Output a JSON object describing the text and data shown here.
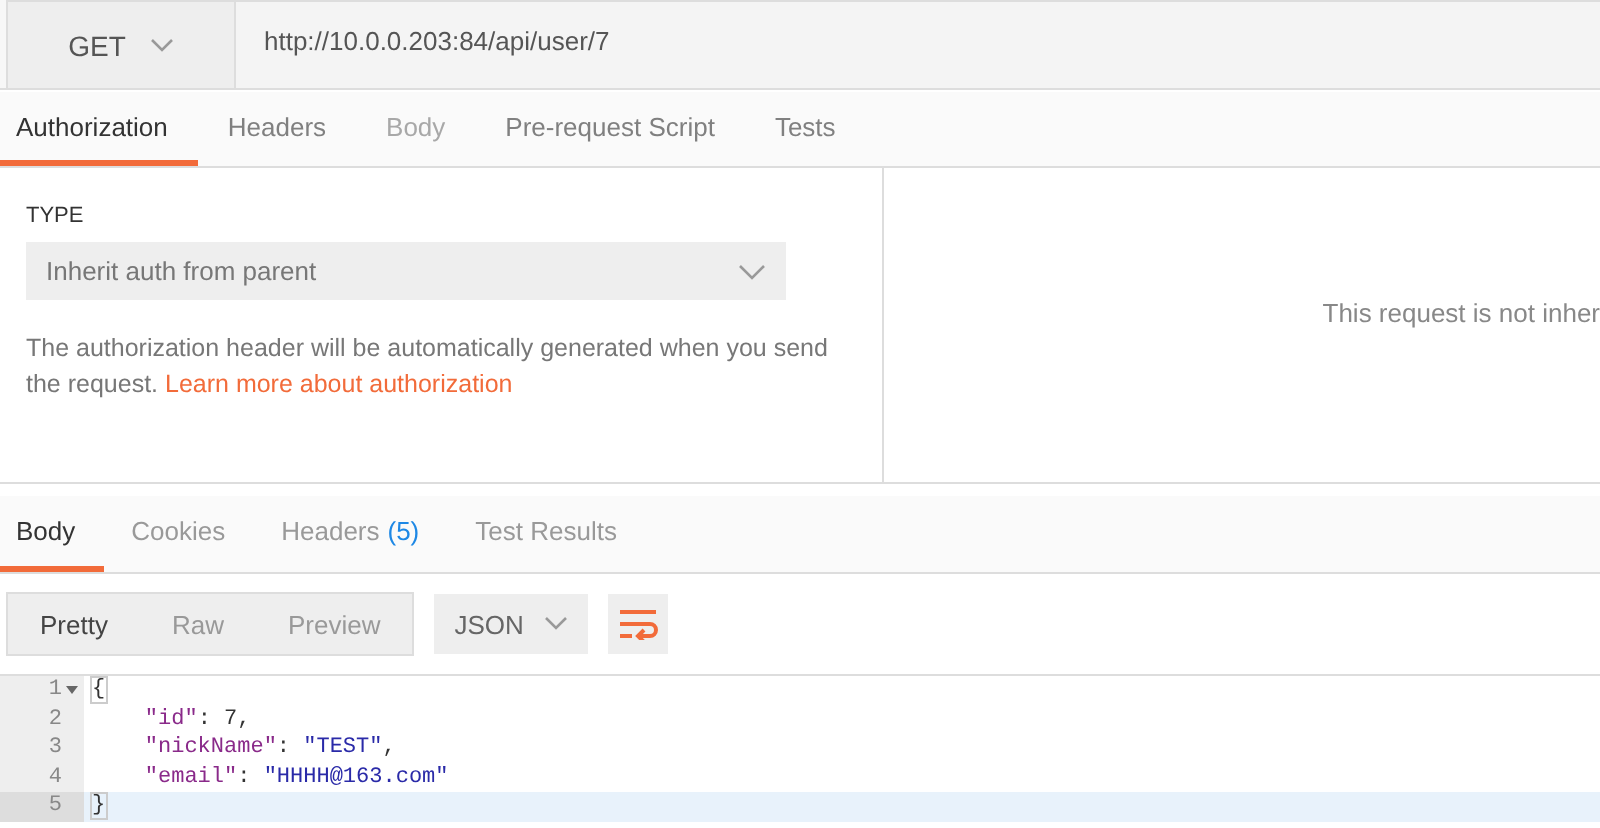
{
  "request": {
    "method": "GET",
    "url": "http://10.0.0.203:84/api/user/7"
  },
  "request_tabs": [
    {
      "label": "Authorization",
      "selected": true,
      "disabled": false
    },
    {
      "label": "Headers",
      "selected": false,
      "disabled": false
    },
    {
      "label": "Body",
      "selected": false,
      "disabled": true
    },
    {
      "label": "Pre-request Script",
      "selected": false,
      "disabled": false
    },
    {
      "label": "Tests",
      "selected": false,
      "disabled": false
    }
  ],
  "auth": {
    "type_label": "TYPE",
    "type_value": "Inherit auth from parent",
    "description": "The authorization header will be automatically generated when you send the request.",
    "link": "Learn more about authorization",
    "side_note": "This request is not inher"
  },
  "response_tabs": [
    {
      "label": "Body",
      "selected": true
    },
    {
      "label": "Cookies",
      "selected": false
    },
    {
      "label": "Headers",
      "count": "(5)",
      "selected": false
    },
    {
      "label": "Test Results",
      "selected": false
    }
  ],
  "view_modes": [
    {
      "label": "Pretty",
      "selected": true
    },
    {
      "label": "Raw",
      "selected": false
    },
    {
      "label": "Preview",
      "selected": false
    }
  ],
  "format": "JSON",
  "code": [
    {
      "number": "1",
      "foldable": true,
      "active": false,
      "tokens": [
        {
          "text": "{",
          "kind": "bracket"
        }
      ]
    },
    {
      "number": "2",
      "foldable": false,
      "active": false,
      "tokens": [
        {
          "text": "    \"id\"",
          "kind": "key"
        },
        {
          "text": ": ",
          "kind": "punct"
        },
        {
          "text": "7",
          "kind": "number"
        },
        {
          "text": ",",
          "kind": "punct"
        }
      ]
    },
    {
      "number": "3",
      "foldable": false,
      "active": false,
      "tokens": [
        {
          "text": "    \"nickName\"",
          "kind": "key"
        },
        {
          "text": ": ",
          "kind": "punct"
        },
        {
          "text": "\"TEST\"",
          "kind": "string"
        },
        {
          "text": ",",
          "kind": "punct"
        }
      ]
    },
    {
      "number": "4",
      "foldable": false,
      "active": false,
      "tokens": [
        {
          "text": "    \"email\"",
          "kind": "key"
        },
        {
          "text": ": ",
          "kind": "punct"
        },
        {
          "text": "\"HHHH@163.com\"",
          "kind": "string"
        }
      ]
    },
    {
      "number": "5",
      "foldable": false,
      "active": true,
      "tokens": [
        {
          "text": "}",
          "kind": "bracket"
        }
      ]
    }
  ]
}
